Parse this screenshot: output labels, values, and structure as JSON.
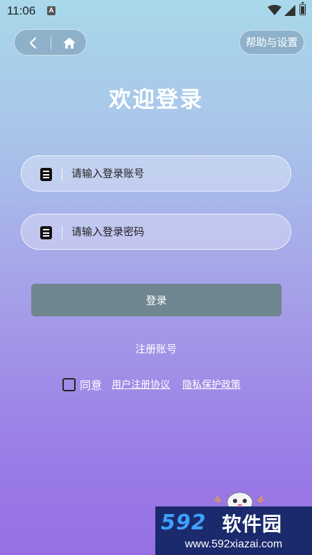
{
  "status_bar": {
    "time": "11:06",
    "notification_icon": "A"
  },
  "nav": {
    "back_icon": "chevron-left-icon",
    "home_icon": "home-icon"
  },
  "header": {
    "help_label": "帮助与设置",
    "title": "欢迎登录"
  },
  "form": {
    "account_placeholder": "请输入登录账号",
    "password_placeholder": "请输入登录密码",
    "login_label": "登录",
    "register_label": "注册账号"
  },
  "agreement": {
    "agree_label": "同意",
    "user_agreement_label": "用户注册协议",
    "privacy_policy_label": "隐私保护政策",
    "checked": false
  },
  "watermark": {
    "logo": "592",
    "name": "软件园",
    "url": "www.592xiazai.com"
  },
  "colors": {
    "login_button": "#6f8590",
    "gradient_top": "#a8d8ea",
    "gradient_bottom": "#9670e4"
  }
}
